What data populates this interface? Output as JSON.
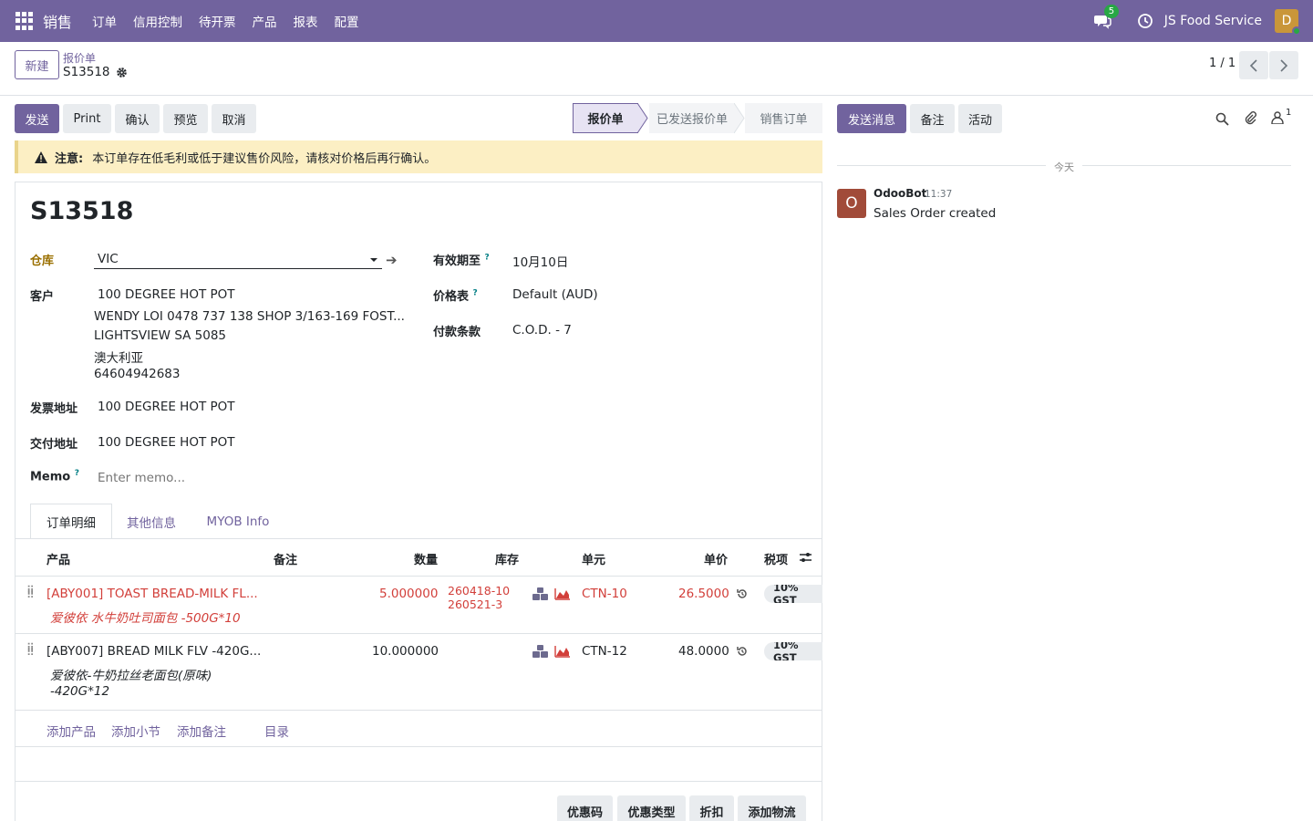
{
  "nav": {
    "app": "销售",
    "menu": [
      "订单",
      "信用控制",
      "待开票",
      "产品",
      "报表",
      "配置"
    ],
    "chat_count": "5",
    "company": "JS Food Service",
    "avatar_letter": "D"
  },
  "control": {
    "new_label": "新建",
    "breadcrumb_parent": "报价单",
    "breadcrumb_current": "S13518",
    "pager": "1 / 1"
  },
  "actions": {
    "send": "发送",
    "print": "Print",
    "confirm": "确认",
    "preview": "预览",
    "cancel": "取消"
  },
  "statusbar": [
    "报价单",
    "已发送报价单",
    "销售订单"
  ],
  "warning": {
    "title": "注意:",
    "text": "本订单存在低毛利或低于建议售价风险，请核对价格后再行确认。"
  },
  "form": {
    "name": "S13518",
    "warehouse_label": "仓库",
    "warehouse_value": "VIC",
    "customer_label": "客户",
    "customer_name": "100 DEGREE HOT POT",
    "customer_address": [
      "WENDY LOI 0478 737 138 SHOP 3/163-169 FOST...",
      "LIGHTSVIEW SA 5085",
      "澳大利亚",
      "64604942683"
    ],
    "invoice_label": "发票地址",
    "invoice_value": "100 DEGREE HOT POT",
    "delivery_label": "交付地址",
    "delivery_value": "100 DEGREE HOT POT",
    "memo_label": "Memo",
    "memo_placeholder": "Enter memo...",
    "validity_label": "有效期至",
    "validity_value": "10月10日",
    "pricelist_label": "价格表",
    "pricelist_value": "Default (AUD)",
    "terms_label": "付款条款",
    "terms_value": "C.O.D. - 7",
    "help_mark": "?"
  },
  "tabs": [
    "订单明细",
    "其他信息",
    "MYOB Info"
  ],
  "table": {
    "headers": [
      "产品",
      "备注",
      "数量",
      "库存",
      "单元",
      "单价",
      "税项"
    ],
    "rows": [
      {
        "product": "[ABY001] TOAST BREAD-MILK FL...",
        "desc": "爱彼依 水牛奶吐司面包 -500G*10",
        "qty": "5.000000",
        "stock1": "260418-10",
        "stock2": "260521-3",
        "unit": "CTN-10",
        "price": "26.5000",
        "tax": "10% GST"
      },
      {
        "product": "[ABY007] BREAD MILK FLV -420G...",
        "desc1": "爱彼依-牛奶拉丝老面包(原味)",
        "desc2": "-420G*12",
        "qty": "10.000000",
        "unit": "CTN-12",
        "price": "48.0000",
        "tax": "10% GST"
      }
    ],
    "links": [
      "添加产品",
      "添加小节",
      "添加备注",
      "目录"
    ]
  },
  "bottom_buttons": [
    "优惠码",
    "优惠类型",
    "折扣",
    "添加物流"
  ],
  "chatter": {
    "send_message": "发送消息",
    "log_note": "备注",
    "activity": "活动",
    "follower_count": "1",
    "today": "今天",
    "author": "OdooBot",
    "author_initial": "O",
    "time": "11:37",
    "message": "Sales Order created"
  },
  "colors": {
    "brand": "#71639e",
    "warning_bg": "#fcefc4",
    "danger": "#d23f3a"
  }
}
